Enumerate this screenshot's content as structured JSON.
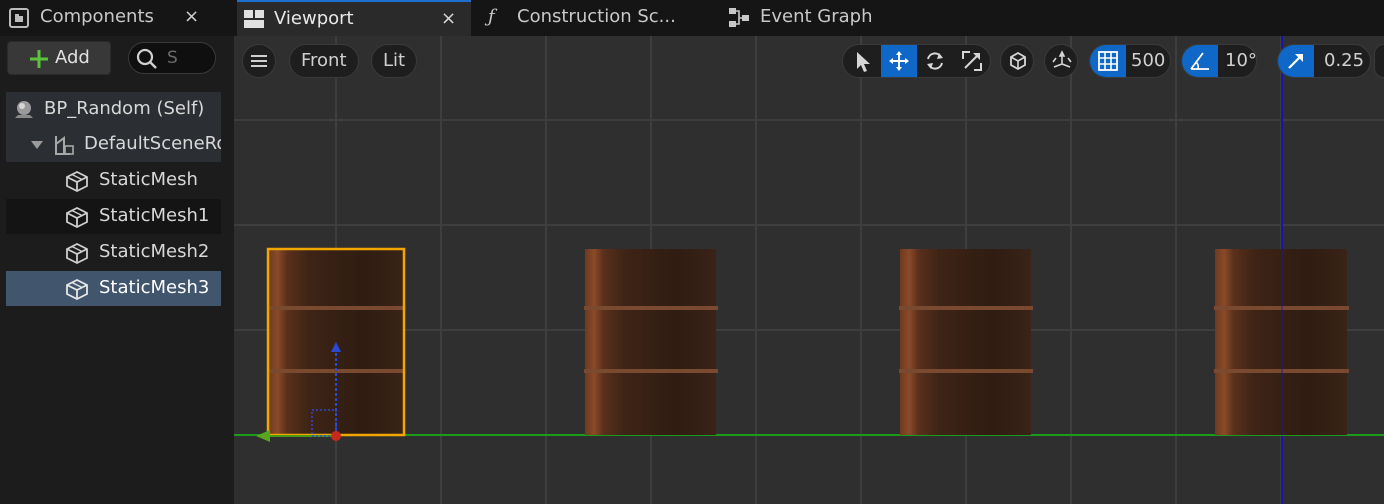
{
  "components_panel": {
    "tab_title": "Components",
    "close_glyph": "×",
    "add_label": "Add",
    "search_placeholder": "S",
    "tree": {
      "self_label": "BP_Random (Self)",
      "root_label": "DefaultSceneRoot",
      "meshes": [
        "StaticMesh",
        "StaticMesh1",
        "StaticMesh2",
        "StaticMesh3"
      ],
      "selected": "StaticMesh3"
    }
  },
  "tabs": {
    "viewport": {
      "label": "Viewport",
      "close_glyph": "×"
    },
    "construction_script": {
      "label": "Construction Sc...",
      "glyph": "ƒ"
    },
    "event_graph": {
      "label": "Event Graph"
    }
  },
  "viewport": {
    "view_mode": "Front",
    "lighting_mode": "Lit",
    "grid_snap_value": "500",
    "rotation_snap_value": "10°",
    "scale_snap_value": "0.25",
    "colors": {
      "accent": "#0f67c7",
      "grid_line": "#3e3e3e",
      "background": "#2f2f2f",
      "x_axis": "#1a9c1a",
      "z_axis": "#1414b4",
      "selection_outline": "#f2a600",
      "barrel_body": "#3b2215"
    },
    "icons": [
      "hamburger-icon",
      "select-arrow-icon",
      "move-icon",
      "rotate-icon",
      "scale-icon",
      "local-space-icon",
      "surface-snap-icon",
      "grid-snap-icon",
      "angle-snap-icon",
      "scale-snap-icon"
    ]
  }
}
